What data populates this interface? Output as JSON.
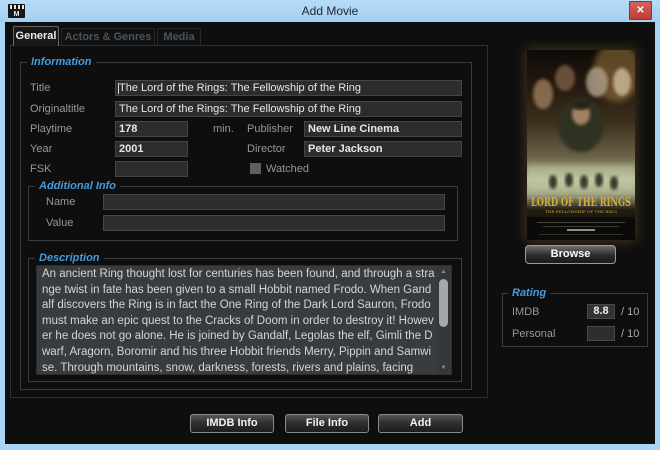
{
  "window": {
    "title": "Add Movie"
  },
  "icons": {
    "close": "✕",
    "scroll_up": "▲",
    "scroll_down": "▼"
  },
  "tabs": {
    "general": "General",
    "actors_genres": "Actors & Genres",
    "media": "Media"
  },
  "information": {
    "legend": "Information",
    "title_label": "Title",
    "title_value": "The Lord of the Rings: The Fellowship of the Ring",
    "originaltitle_label": "Originaltitle",
    "originaltitle_value": "The Lord of the Rings: The Fellowship of the Ring",
    "playtime_label": "Playtime",
    "playtime_value": "178",
    "playtime_unit": "min.",
    "publisher_label": "Publisher",
    "publisher_value": "New Line Cinema",
    "year_label": "Year",
    "year_value": "2001",
    "director_label": "Director",
    "director_value": "Peter Jackson",
    "fsk_label": "FSK",
    "fsk_value": "",
    "watched_label": "Watched"
  },
  "additional_info": {
    "legend": "Additional Info",
    "name_label": "Name",
    "name_value": "",
    "value_label": "Value",
    "value_value": ""
  },
  "description": {
    "legend": "Description",
    "text": "An ancient Ring thought lost for centuries has been found, and through a strange twist in fate has been given to a small Hobbit named Frodo. When Gandalf discovers the Ring is in fact the One Ring of the Dark Lord Sauron, Frodo must make an epic quest to the Cracks of Doom in order to destroy it! However he does not go alone. He is joined by Gandalf, Legolas the elf, Gimli the Dwarf, Aragorn, Boromir and his three Hobbit friends Merry, Pippin and Samwise. Through mountains, snow, darkness, forests, rivers and plains, facing"
  },
  "poster": {
    "title": "LORD OF THE RINGS",
    "subtitle": "THE FELLOWSHIP OF THE RING"
  },
  "browse": {
    "label": "Browse"
  },
  "rating": {
    "legend": "Rating",
    "imdb_label": "IMDB",
    "imdb_value": "8.8",
    "imdb_suffix": "/ 10",
    "personal_label": "Personal",
    "personal_value": "",
    "personal_suffix": "/ 10"
  },
  "footer": {
    "imdb_info": "IMDB Info",
    "file_info": "File Info",
    "add": "Add"
  },
  "colors": {
    "accent": "#449ce0",
    "titlebar": "#a9d4f4",
    "close_red": "#c7433c"
  }
}
